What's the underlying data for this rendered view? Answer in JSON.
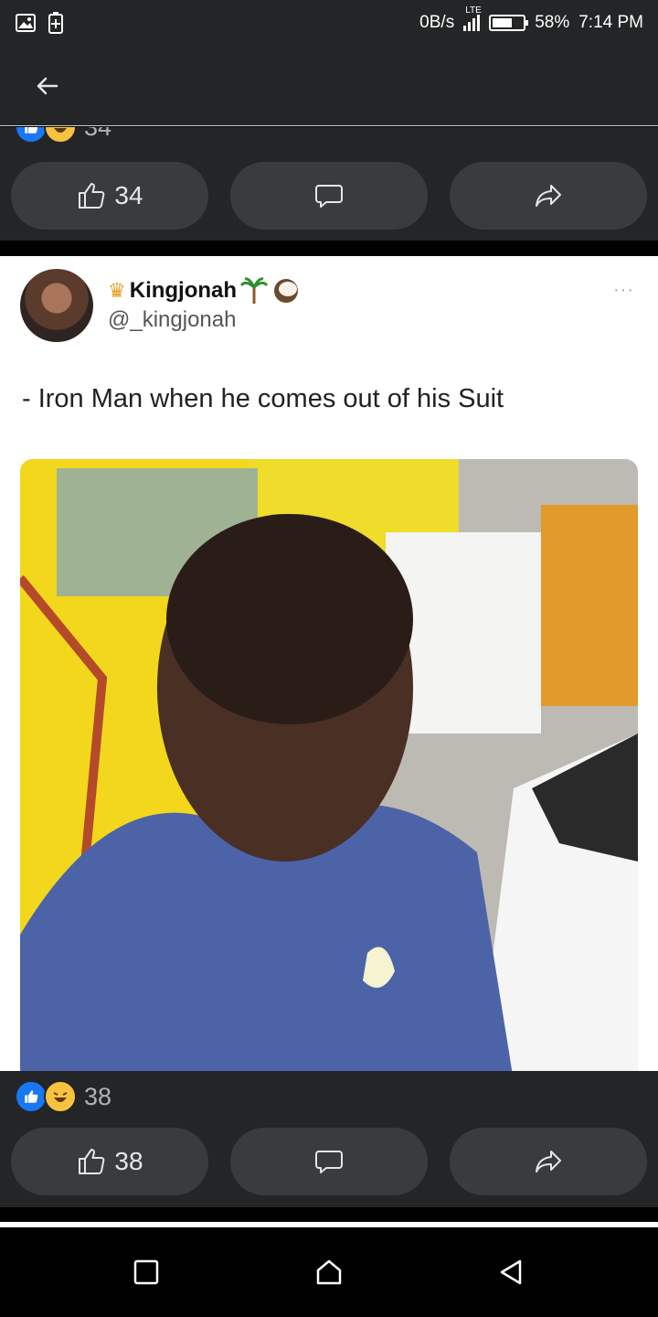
{
  "status_bar": {
    "net_speed": "0B/s",
    "network": "LTE",
    "battery": "58%",
    "time": "7:14 PM",
    "battery_level": 0.58
  },
  "header": {
    "back_icon": "arrow-left-icon"
  },
  "first_post_actions": {
    "partial_reaction_count": "34",
    "like_count": "34"
  },
  "post": {
    "author_name": "Kingjonah",
    "handle": "@_kingjonah",
    "more": "···",
    "text": "- Iron Man when he comes out of his Suit",
    "reaction_count": "38",
    "like_count": "38"
  },
  "nav": {
    "recent_icon": "square-icon",
    "home_icon": "home-icon",
    "back_icon": "triangle-back-icon"
  },
  "colors": {
    "dark_bg": "#242526",
    "button_bg": "#3a3b3c",
    "like_blue": "#1877f2",
    "haha_yellow": "#f7c240"
  }
}
